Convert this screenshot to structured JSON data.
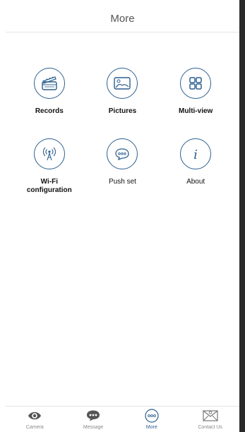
{
  "header": {
    "title": "More"
  },
  "menu": {
    "items": [
      {
        "label": "Records",
        "icon": "clapperboard-icon"
      },
      {
        "label": "Pictures",
        "icon": "picture-icon"
      },
      {
        "label": "Multi-view",
        "icon": "grid-icon"
      },
      {
        "label": "Wi-Fi configuration",
        "icon": "wifi-antenna-icon"
      },
      {
        "label": "Push set",
        "icon": "chat-bubble-icon"
      },
      {
        "label": "About",
        "icon": "info-icon"
      }
    ]
  },
  "tabbar": {
    "items": [
      {
        "label": "Camera",
        "icon": "eye-icon",
        "active": false
      },
      {
        "label": "Message",
        "icon": "message-icon",
        "active": false
      },
      {
        "label": "More",
        "icon": "more-icon",
        "active": true
      },
      {
        "label": "Contact Us",
        "icon": "envelope-icon",
        "active": false
      }
    ]
  },
  "colors": {
    "accent": "#2c5f8e",
    "text": "#111111",
    "muted": "#888888"
  }
}
